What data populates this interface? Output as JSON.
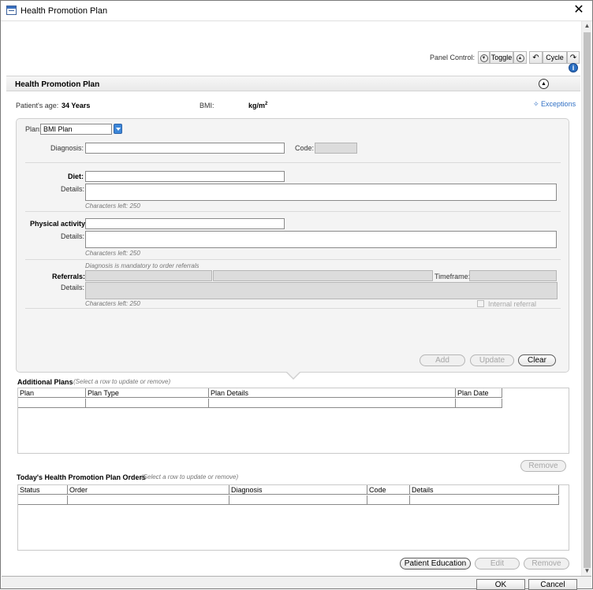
{
  "window": {
    "title": "Health Promotion Plan"
  },
  "panel_control": {
    "label": "Panel Control:",
    "toggle_label": "Toggle",
    "cycle_label": "Cycle"
  },
  "section": {
    "title": "Health Promotion Plan"
  },
  "patient": {
    "age_label": "Patient's age:",
    "age_value": "34 Years",
    "bmi_label": "BMI:",
    "bmi_unit": "kg/m",
    "bmi_unit_exp": "2"
  },
  "exceptions": {
    "label": "Exceptions"
  },
  "plan": {
    "plan_label": "Plan:",
    "plan_value": "BMI Plan",
    "diagnosis_label": "Diagnosis:",
    "code_label": "Code:",
    "diet_label": "Diet:",
    "details_label": "Details:",
    "chars_left": "Characters left: 250",
    "physical_label": "Physical activity:",
    "referrals_note": "Diagnosis is mandatory to order referrals",
    "referrals_label": "Referrals:",
    "timeframe_label": "Timeframe:",
    "internal_referral_label": "Internal referral",
    "add_label": "Add",
    "update_label": "Update",
    "clear_label": "Clear"
  },
  "additional_plans": {
    "title": "Additional Plans",
    "hint": "(Select a row to update or remove)",
    "columns": [
      "Plan",
      "Plan Type",
      "Plan Details",
      "Plan Date"
    ],
    "remove_label": "Remove"
  },
  "orders": {
    "title": "Today's Health Promotion Plan Orders",
    "hint": "(Select a row to update or remove)",
    "columns": [
      "Status",
      "Order",
      "Diagnosis",
      "Code",
      "Details"
    ],
    "patient_education_label": "Patient Education",
    "edit_label": "Edit",
    "remove_label": "Remove"
  },
  "footer": {
    "ok_label": "OK",
    "cancel_label": "Cancel"
  }
}
